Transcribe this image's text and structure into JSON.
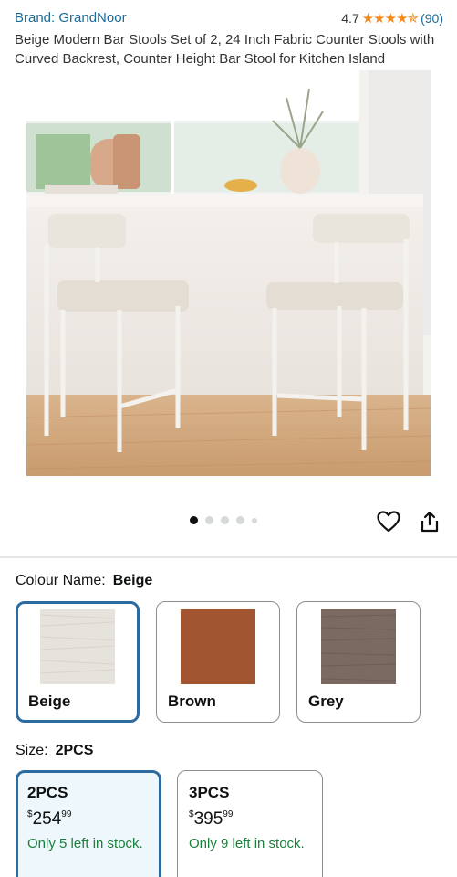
{
  "product": {
    "brand_label": "Brand: GrandNoor",
    "rating_value": "4.7",
    "stars": "★★★★✯",
    "review_count": "(90)",
    "title": "Beige Modern Bar Stools Set of 2, 24 Inch Fabric Counter Stools with Curved Backrest, Counter Height Bar Stool for Kitchen Island"
  },
  "carousel": {
    "total_images": 5,
    "active_index": 0
  },
  "actions": {
    "wishlist_icon": "heart-icon",
    "share_icon": "share-icon"
  },
  "colour": {
    "label": "Colour Name:",
    "selected": "Beige",
    "options": [
      {
        "name": "Beige",
        "swatch_color": "#e6e2dc"
      },
      {
        "name": "Brown",
        "swatch_color": "#a85a35"
      },
      {
        "name": "Grey",
        "swatch_color": "#7b6a62"
      }
    ]
  },
  "size": {
    "label": "Size:",
    "selected": "2PCS",
    "options": [
      {
        "name": "2PCS",
        "currency": "$",
        "price_whole": "254",
        "price_fraction": "99",
        "stock": "Only 5 left in stock."
      },
      {
        "name": "3PCS",
        "currency": "$",
        "price_whole": "395",
        "price_fraction": "99",
        "stock": "Only 9 left in stock."
      }
    ]
  },
  "colors": {
    "link": "#1a6a9a",
    "star": "#f08a1c",
    "selected_border": "#2c6aa0",
    "stock_green": "#1b7f3a"
  }
}
